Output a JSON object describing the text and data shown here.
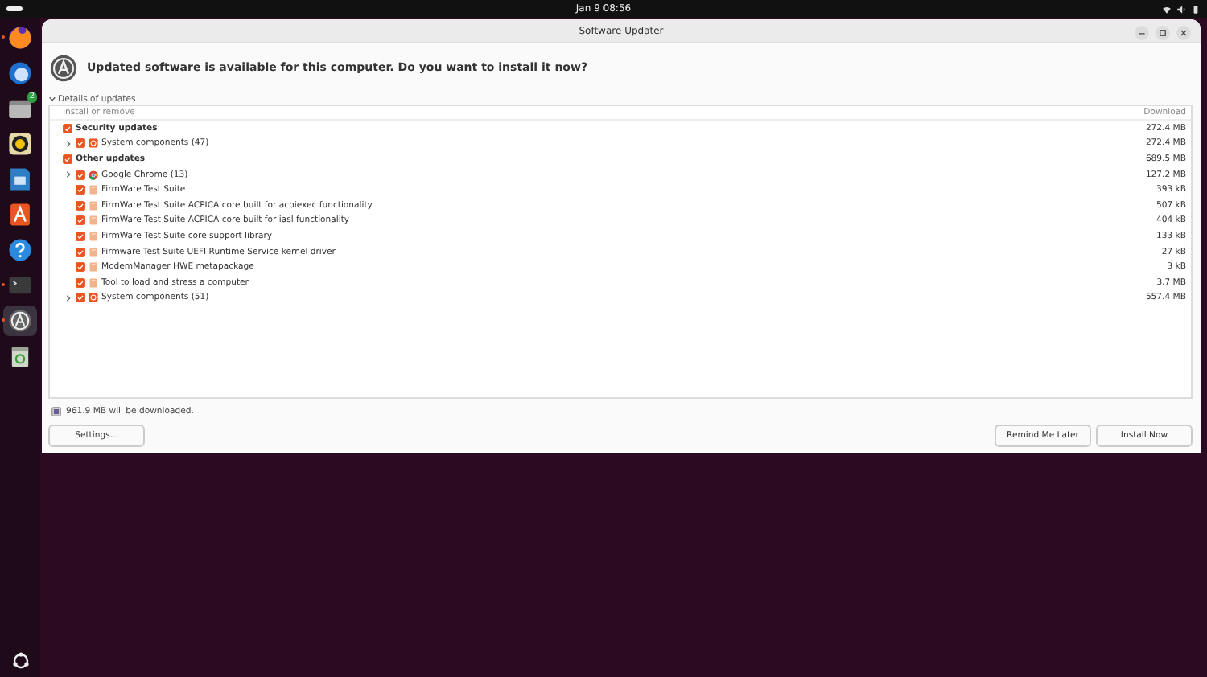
{
  "top_bar": {
    "clock": "Jan 9  08:56"
  },
  "dock": {
    "apps": [
      {
        "kind": "firefox",
        "running": true,
        "selected": false
      },
      {
        "kind": "mail",
        "running": false,
        "selected": false
      },
      {
        "kind": "files",
        "running": false,
        "selected": false,
        "badge": "2"
      },
      {
        "kind": "music",
        "running": false,
        "selected": false
      },
      {
        "kind": "writer",
        "running": false,
        "selected": false
      },
      {
        "kind": "store",
        "running": false,
        "selected": false
      },
      {
        "kind": "help",
        "running": false,
        "selected": false
      },
      {
        "kind": "terminal",
        "running": true,
        "selected": false
      },
      {
        "kind": "updater",
        "running": true,
        "selected": true
      },
      {
        "kind": "trash",
        "running": false,
        "selected": false
      }
    ]
  },
  "window": {
    "title": "Software Updater",
    "headline": "Updated software is available for this computer. Do you want to install it now?",
    "details": {
      "label": "Details of updates",
      "expanded": true
    },
    "table": {
      "columns": [
        "Install or remove",
        "Download"
      ],
      "groups": [
        {
          "name": "Security updates",
          "checked": true,
          "size": "272.4 MB",
          "children": [
            {
              "name": "System components (47)",
              "kind": "system",
              "checked": true,
              "expandable": true,
              "size": "272.4 MB"
            }
          ]
        },
        {
          "name": "Other updates",
          "checked": true,
          "size": "689.5 MB",
          "children": [
            {
              "name": "Google Chrome (13)",
              "kind": "browser",
              "checked": true,
              "expandable": true,
              "size": "127.2 MB"
            },
            {
              "name": "FirmWare Test Suite",
              "kind": "package",
              "checked": true,
              "expandable": false,
              "size": "393 kB"
            },
            {
              "name": "FirmWare Test Suite ACPICA core built for acpiexec functionality",
              "kind": "package",
              "checked": true,
              "expandable": false,
              "size": "507 kB"
            },
            {
              "name": "FirmWare Test Suite ACPICA core built for iasl functionality",
              "kind": "package",
              "checked": true,
              "expandable": false,
              "size": "404 kB"
            },
            {
              "name": "FirmWare Test Suite core support library",
              "kind": "package",
              "checked": true,
              "expandable": false,
              "size": "133 kB"
            },
            {
              "name": "Firmware Test Suite UEFI Runtime Service kernel driver",
              "kind": "package",
              "checked": true,
              "expandable": false,
              "size": "27 kB"
            },
            {
              "name": "ModemManager HWE metapackage",
              "kind": "package",
              "checked": true,
              "expandable": false,
              "size": "3 kB"
            },
            {
              "name": "Tool to load and stress a computer",
              "kind": "package",
              "checked": true,
              "expandable": false,
              "size": "3.7 MB"
            },
            {
              "name": "System components (51)",
              "kind": "system",
              "checked": true,
              "expandable": true,
              "size": "557.4 MB"
            }
          ]
        }
      ]
    },
    "summary": "961.9 MB will be downloaded.",
    "buttons": {
      "left": [
        "Settings..."
      ],
      "right": [
        "Remind Me Later",
        "Install Now"
      ]
    }
  }
}
